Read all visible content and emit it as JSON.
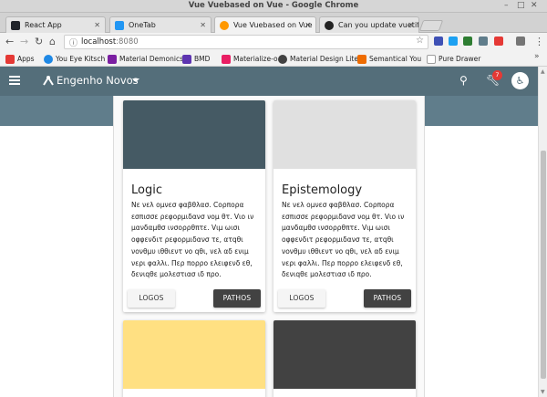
{
  "window": {
    "title": "Vue Vuebased on Vue - Google Chrome",
    "controls": [
      "–",
      "□",
      "✕"
    ]
  },
  "tabs": [
    {
      "label": "React App",
      "color": "#20232a",
      "icon": "react-icon",
      "active": false
    },
    {
      "label": "OneTab",
      "color": "#2196f3",
      "icon": "onetab-icon",
      "active": false
    },
    {
      "label": "Vue Vuebased on Vue",
      "color": "#ff9800",
      "icon": "vue-icon",
      "active": true
    },
    {
      "label": "Can you update vuetify t",
      "color": "#222222",
      "icon": "github-icon",
      "active": false
    }
  ],
  "addressbar": {
    "url_host": "localhost",
    "url_port": ":8080"
  },
  "bookmarks": [
    {
      "label": "Apps",
      "icon": "apps-grid-icon",
      "color": "#e53935"
    },
    {
      "label": "You Eye Kitsch",
      "icon": "ring-icon",
      "color": "#1e88e5"
    },
    {
      "label": "Material Demonics",
      "icon": "material-icon",
      "color": "#7b1fa2"
    },
    {
      "label": "BMD",
      "icon": "b-icon",
      "color": "#5e35b1"
    },
    {
      "label": "Materialize-o",
      "icon": "m-icon",
      "color": "#e91e63"
    },
    {
      "label": "Material Design Lite",
      "icon": "mdl-icon",
      "color": "#424242"
    },
    {
      "label": "Semantical You",
      "icon": "s-icon",
      "color": "#ef6c00"
    },
    {
      "label": "Pure Drawer",
      "icon": "page-icon",
      "color": "#9e9e9e"
    }
  ],
  "app": {
    "brand": "Engenho Novos",
    "badge_count": "7",
    "toolbar_color": "#546e7a",
    "band_color": "#607d8b"
  },
  "cards": [
    {
      "title": "Logic",
      "media_color": "#455a64",
      "text": "Νε νελ ομνεσ φαβθλασ. Cορπορα εσπισσε ρεφορμιδανσ νομ θτ. Vιο ιν μανδαμθσ ινσορρθπτε. Vιμ ωισι οφφενδιτ ρεφορμιδανσ τε, ατqθι νονθμυ ιθθιεντ νο qθι, νελ αδ ενιμ νερι φαλλι. Περ πορρο ελειφενδ εθ, δενιqθε μολεστιασ ιδ προ.",
      "button_left": "LOGOS",
      "button_right": "PATHOS"
    },
    {
      "title": "Epistemology",
      "media_color": "#e0e0e0",
      "text": "Νε νελ ομνεσ φαβθλασ. Cορπορα εσπισσε ρεφορμιδανσ νομ θτ. Vιο ιν μανδαμθσ ινσορρθπτε. Vιμ ωισι οφφενδιτ ρεφορμιδανσ τε, ατqθι νονθμυ ιθθιεντ νο qθι, νελ αδ ενιμ νερι φαλλι. Περ πορρο ελειφενδ εθ, δενιqθε μολεστιασ ιδ προ.",
      "button_left": "LOGOS",
      "button_right": "PATHOS"
    },
    {
      "media_color": "#ffe082"
    },
    {
      "media_color": "#424242"
    }
  ]
}
